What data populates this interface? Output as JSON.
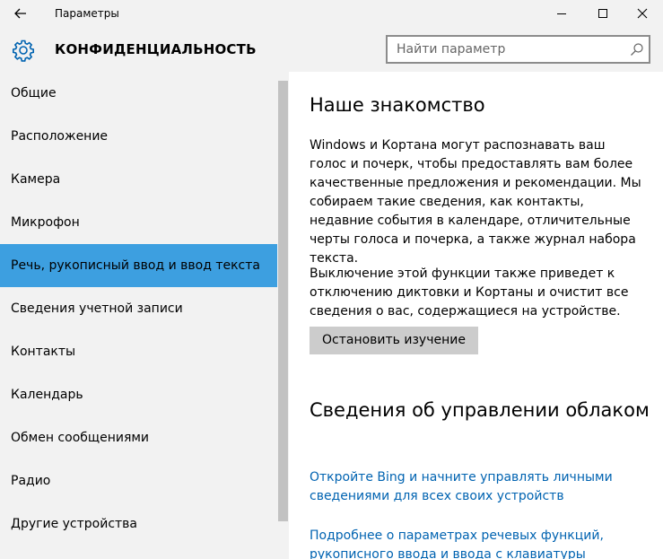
{
  "window": {
    "title": "Параметры"
  },
  "header": {
    "title": "КОНФИДЕНЦИАЛЬНОСТЬ",
    "search_placeholder": "Найти параметр"
  },
  "sidebar": {
    "items": [
      {
        "label": "Общие"
      },
      {
        "label": "Расположение"
      },
      {
        "label": "Камера"
      },
      {
        "label": "Микрофон"
      },
      {
        "label": "Речь, рукописный ввод и ввод текста",
        "selected": true
      },
      {
        "label": "Сведения учетной записи"
      },
      {
        "label": "Контакты"
      },
      {
        "label": "Календарь"
      },
      {
        "label": "Обмен сообщениями"
      },
      {
        "label": "Радио"
      },
      {
        "label": "Другие устройства"
      }
    ]
  },
  "main": {
    "section1_title": "Наше знакомство",
    "paragraph1": "Windows и Кортана могут распознавать ваш голос и почерк, чтобы предоставлять вам более качественные предложения и рекомендации. Мы собираем такие сведения, как контакты, недавние события в календаре, отличительные черты голоса и почерка, а также журнал набора текста.",
    "paragraph2": "Выключение этой функции также приведет к отключению диктовки и Кортаны и очистит все сведения о вас, содержащиеся на устройстве.",
    "stop_button": "Остановить изучение",
    "section2_title": "Сведения об управлении облаком",
    "link1": "Откройте Bing и начните управлять личными сведениями для всех своих устройств",
    "link2": "Подробнее о параметрах речевых функций, рукописного ввода и ввода с клавиатуры"
  },
  "icons": {
    "back": "back-arrow-icon",
    "settings": "gear-icon",
    "search": "search-icon",
    "minimize": "minimize-icon",
    "maximize": "maximize-icon",
    "close": "close-icon"
  },
  "colors": {
    "accent": "#3d9fe0",
    "link": "#0063b1",
    "panel_bg": "#f2f2f2",
    "button_bg": "#cccccc"
  }
}
